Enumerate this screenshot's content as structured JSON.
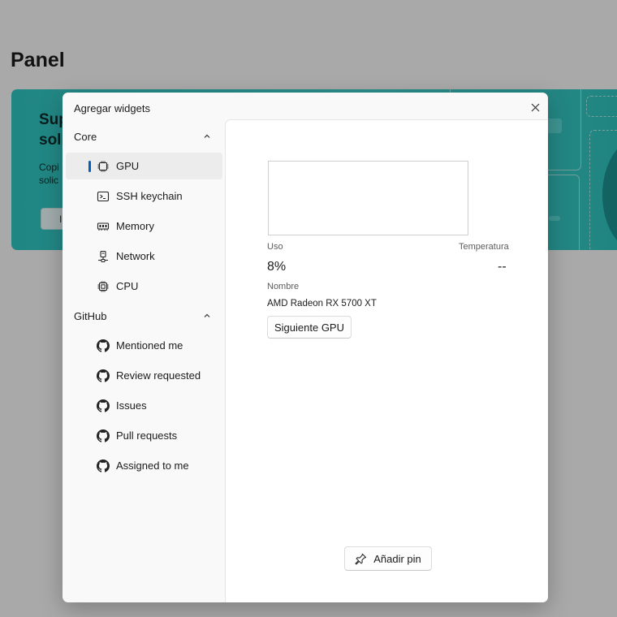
{
  "page": {
    "title": "Panel"
  },
  "banner": {
    "heading": "Sup\nsoli",
    "text": "Copi\nsolic",
    "button_label": "I"
  },
  "dialog": {
    "title": "Agregar widgets",
    "close_icon": "close-icon",
    "sidebar": {
      "groups": [
        {
          "label": "Core",
          "expanded": true,
          "items": [
            {
              "label": "GPU",
              "icon": "gpu-icon",
              "selected": true
            },
            {
              "label": "SSH keychain",
              "icon": "terminal-icon",
              "selected": false
            },
            {
              "label": "Memory",
              "icon": "memory-icon",
              "selected": false
            },
            {
              "label": "Network",
              "icon": "network-icon",
              "selected": false
            },
            {
              "label": "CPU",
              "icon": "cpu-icon",
              "selected": false
            }
          ]
        },
        {
          "label": "GitHub",
          "expanded": true,
          "items": [
            {
              "label": "Mentioned me",
              "icon": "github-icon",
              "selected": false
            },
            {
              "label": "Review requested",
              "icon": "github-icon",
              "selected": false
            },
            {
              "label": "Issues",
              "icon": "github-icon",
              "selected": false
            },
            {
              "label": "Pull requests",
              "icon": "github-icon",
              "selected": false
            },
            {
              "label": "Assigned to me",
              "icon": "github-icon",
              "selected": false
            }
          ]
        }
      ]
    },
    "preview": {
      "usage_label": "Uso",
      "usage_value": "8%",
      "temperature_label": "Temperatura",
      "temperature_value": "--",
      "name_label": "Nombre",
      "name_value": "AMD Radeon RX 5700 XT",
      "next_button": "Siguiente GPU",
      "pin_button": "Añadir pin"
    }
  },
  "colors": {
    "accent": "#005fb8",
    "banner": "#3fcdc8"
  }
}
